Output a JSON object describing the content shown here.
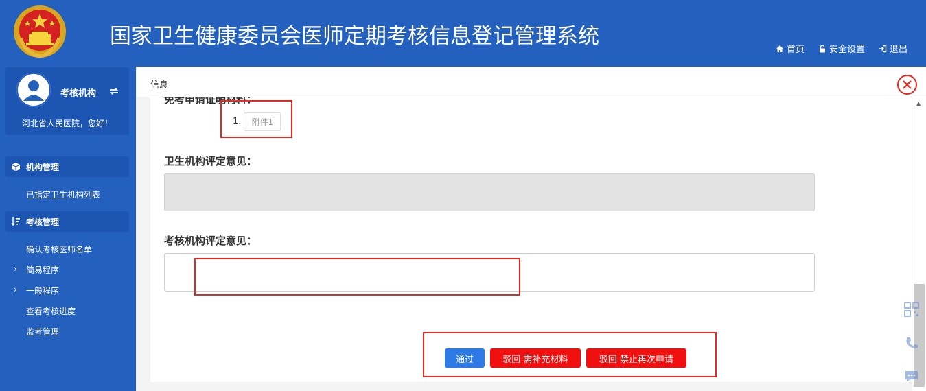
{
  "header": {
    "title": "国家卫生健康委员会医师定期考核信息登记管理系统",
    "nav": [
      {
        "icon": "home-icon",
        "label": "首页"
      },
      {
        "icon": "lock-icon",
        "label": "安全设置"
      },
      {
        "icon": "logout-icon",
        "label": "退出"
      }
    ]
  },
  "sidebar": {
    "role": "考核机构",
    "greeting": "河北省人民医院，您好！",
    "groups": [
      {
        "icon": "cube-icon",
        "label": "机构管理",
        "items": [
          {
            "label": "已指定卫生机构列表"
          }
        ]
      },
      {
        "icon": "sort-icon",
        "label": "考核管理",
        "items": [
          {
            "label": "确认考核医师名单",
            "chevron": ""
          },
          {
            "label": "简易程序",
            "chevron": "›"
          },
          {
            "label": "一般程序",
            "chevron": "›"
          },
          {
            "label": "查看考核进度",
            "chevron": ""
          },
          {
            "label": "监考管理",
            "chevron": ""
          }
        ]
      }
    ]
  },
  "tab": {
    "label": "信息"
  },
  "form": {
    "exempt_label": "免考申请证明材料：",
    "attachment_index": "1.",
    "attachment_label": "附件1",
    "health_opinion_label": "卫生机构评定意见：",
    "health_opinion_value": "",
    "exam_opinion_label": "考核机构评定意见：",
    "exam_opinion_value": ""
  },
  "actions": {
    "approve": "通过",
    "reject_supplement": "驳回 需补充材料",
    "reject_forbid": "驳回 禁止再次申请"
  },
  "colors": {
    "brand": "#2460bd",
    "approve": "#2d7ae6",
    "reject": "#f01010",
    "highlight": "#e8271f"
  }
}
